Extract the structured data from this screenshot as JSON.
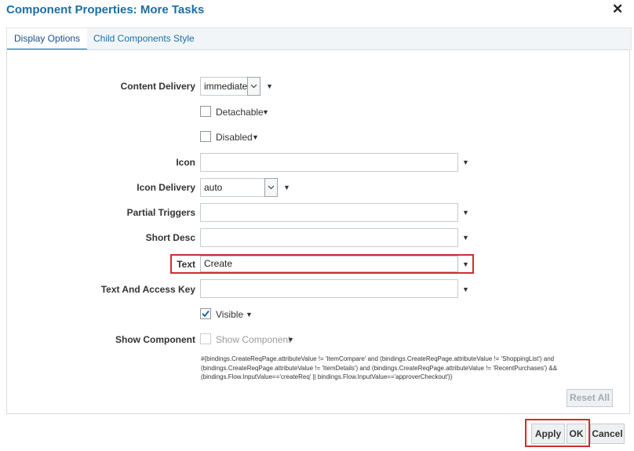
{
  "dialog": {
    "title": "Component Properties: More Tasks",
    "close_glyph": "✕"
  },
  "tabs": [
    {
      "label": "Display Options",
      "active": true
    },
    {
      "label": "Child Components",
      "active": false
    },
    {
      "label": "Style",
      "active": false
    }
  ],
  "fields": {
    "content_delivery": {
      "label": "Content Delivery",
      "value": "immediate"
    },
    "detachable": {
      "label": "Detachable",
      "checked": false
    },
    "disabled": {
      "label": "Disabled",
      "checked": false
    },
    "icon": {
      "label": "Icon",
      "value": ""
    },
    "icon_delivery": {
      "label": "Icon Delivery",
      "value": "auto"
    },
    "partial_triggers": {
      "label": "Partial Triggers",
      "value": ""
    },
    "short_desc": {
      "label": "Short Desc",
      "value": ""
    },
    "text": {
      "label": "Text",
      "value": "Create"
    },
    "text_and_access_key": {
      "label": "Text And Access Key",
      "value": ""
    },
    "visible": {
      "label": "Visible",
      "checked": true
    },
    "show_component": {
      "label": "Show Component",
      "checkbox_label": "Show Component",
      "checked": false,
      "enabled": false
    },
    "expression": [
      "#{bindings.CreateReqPage.attributeValue != 'ItemCompare' and (bindings.CreateReqPage.attributeValue != 'ShoppingList') and",
      "(bindings.CreateReqPage.attributeValue != 'ItemDetails') and (bindings.CreateReqPage.attributeValue != 'RecentPurchases') &&",
      "(bindings.Flow.InputValue=='createReq' || bindings.Flow.InputValue=='approverCheckout')}"
    ]
  },
  "buttons": {
    "reset_all": "Reset All",
    "apply": "Apply",
    "ok": "OK",
    "cancel": "Cancel"
  },
  "colors": {
    "title": "#1c6ea4",
    "highlight": "#d42a33",
    "check": "#1d6ab5"
  }
}
